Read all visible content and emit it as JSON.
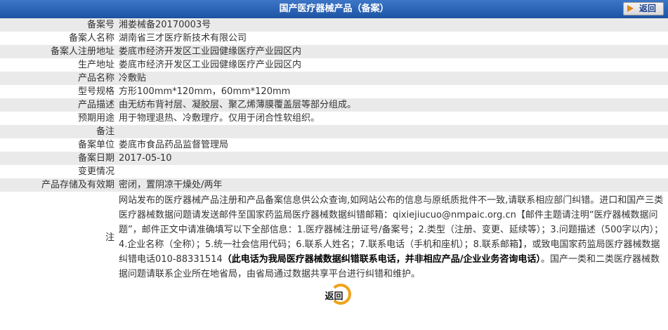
{
  "header": {
    "title": "国产医疗器械产品（备案）",
    "back_label": "返回"
  },
  "rows": [
    {
      "label": "备案号",
      "value": "湘娄械备20170003号"
    },
    {
      "label": "备案人名称",
      "value": "湖南省三才医疗新技术有限公司"
    },
    {
      "label": "备案人注册地址",
      "value": "娄底市经济开发区工业园健缘医疗产业园区内"
    },
    {
      "label": "生产地址",
      "value": "娄底市经济开发区工业园健缘医疗产业园区内"
    },
    {
      "label": "产品名称",
      "value": "冷敷贴"
    },
    {
      "label": "型号规格",
      "value": "方形100mm*120mm，60mm*120mm"
    },
    {
      "label": "产品描述",
      "value": "由无纺布背衬层、凝胶层、聚乙烯薄膜覆盖层等部分组成。"
    },
    {
      "label": "预期用途",
      "value": "用于物理退热、冷敷理疗。仅用于闭合性软组织。"
    },
    {
      "label": "备注",
      "value": ""
    },
    {
      "label": "备案单位",
      "value": "娄底市食品药品监督管理局"
    },
    {
      "label": "备案日期",
      "value": "2017-05-10"
    },
    {
      "label": "变更情况",
      "value": ""
    },
    {
      "label": "产品存储及有效期",
      "value": "密闭，置阴凉干燥处/两年"
    }
  ],
  "note": {
    "label": "注",
    "part1": "网站发布的医疗器械产品注册和产品备案信息供公众查询,如网站公布的信息与原纸质批件不一致,请联系相应部门纠错。进口和国产三类医疗器械数据问题请发送邮件至国家药监局医疗器械数据纠错邮箱：qixiejiucuo@nmpaic.org.cn【邮件主题请注明“医疗器械数据问题”，邮件正文中请准确填写以下全部信息：1.医疗器械注册证号/备案号；2.类型（注册、变更、延续等）；3.问题描述（500字以内）；4.企业名称（全称）；5.统一社会信用代码；6.联系人姓名；7.联系电话（手机和座机）；8.联系邮箱】，或致电国家药监局医疗器械数据纠错电话010-88331514",
    "bold": "（此电话为我局医疗器械数据纠错联系电话，并非相应产品/企业业务咨询电话）",
    "part2": "。国产一类和二类医疗器械数据问题请联系企业所在地省局，由省局通过数据共享平台进行纠错和维护。"
  },
  "footer": {
    "back_label": "返回"
  }
}
